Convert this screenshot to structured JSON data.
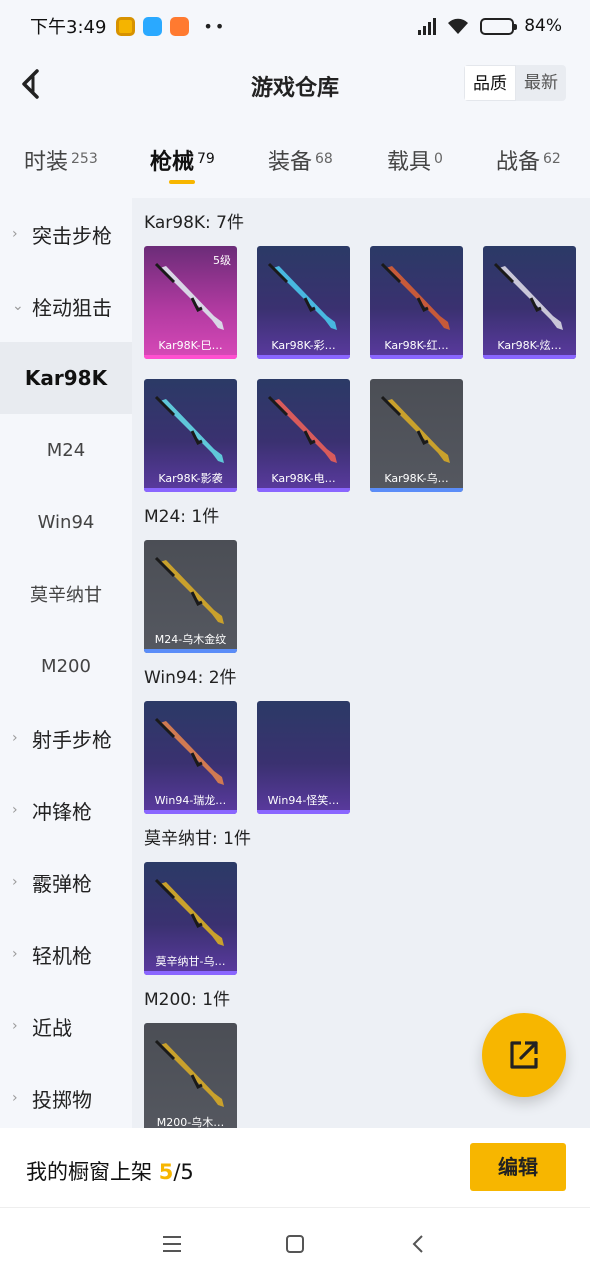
{
  "status": {
    "time": "下午3:49",
    "battery_text": "84%",
    "battery_level": 0.84,
    "app_icons": [
      "wallet-app-icon",
      "chat-app-icon",
      "shop-app-icon"
    ],
    "more": "••"
  },
  "header": {
    "title": "游戏仓库",
    "sort_options": [
      "品质",
      "最新"
    ],
    "sort_selected": "品质"
  },
  "tabs": [
    {
      "label": "时装",
      "count": "253",
      "active": false
    },
    {
      "label": "枪械",
      "count": "79",
      "active": true
    },
    {
      "label": "装备",
      "count": "68",
      "active": false
    },
    {
      "label": "载具",
      "count": "0",
      "active": false
    },
    {
      "label": "战备",
      "count": "62",
      "active": false
    }
  ],
  "sidebar": {
    "items": [
      {
        "label": "突击步枪",
        "type": "group",
        "chevron": "›"
      },
      {
        "label": "栓动狙击",
        "type": "group",
        "chevron": "⌄"
      },
      {
        "label": "Kar98K",
        "type": "sub",
        "active": true
      },
      {
        "label": "M24",
        "type": "sub"
      },
      {
        "label": "Win94",
        "type": "sub"
      },
      {
        "label": "莫辛纳甘",
        "type": "sub"
      },
      {
        "label": "M200",
        "type": "sub"
      },
      {
        "label": "射手步枪",
        "type": "group",
        "chevron": "›"
      },
      {
        "label": "冲锋枪",
        "type": "group",
        "chevron": "›"
      },
      {
        "label": "霰弹枪",
        "type": "group",
        "chevron": "›"
      },
      {
        "label": "轻机枪",
        "type": "group",
        "chevron": "›"
      },
      {
        "label": "近战",
        "type": "group",
        "chevron": "›"
      },
      {
        "label": "投掷物",
        "type": "group",
        "chevron": "›"
      }
    ]
  },
  "sections": [
    {
      "title": "Kar98K: 7件",
      "items": [
        {
          "name": "Kar98K-巳…",
          "rarity": "pink",
          "level": "5级",
          "gun_color": "#d9d6e6"
        },
        {
          "name": "Kar98K-彩…",
          "rarity": "purple",
          "gun_color": "#48b8e0"
        },
        {
          "name": "Kar98K-红…",
          "rarity": "purple",
          "gun_color": "#c75a3a"
        },
        {
          "name": "Kar98K-炫…",
          "rarity": "purple",
          "gun_color": "#c9c7d8"
        },
        {
          "name": "Kar98K-影袭",
          "rarity": "purple",
          "gun_color": "#5fc7d9"
        },
        {
          "name": "Kar98K-电…",
          "rarity": "purple",
          "gun_color": "#d85b5b"
        },
        {
          "name": "Kar98K-乌…",
          "rarity": "grey",
          "gun_color": "#c9a12c"
        }
      ]
    },
    {
      "title": "M24: 1件",
      "items": [
        {
          "name": "M24-乌木金纹",
          "rarity": "grey",
          "gun_color": "#c9a12c"
        }
      ]
    },
    {
      "title": "Win94: 2件",
      "items": [
        {
          "name": "Win94-瑞龙…",
          "rarity": "purple",
          "gun_color": "#d07a52"
        },
        {
          "name": "Win94-怪笑…",
          "rarity": "purple",
          "gun_color": ""
        }
      ]
    },
    {
      "title": "莫辛纳甘: 1件",
      "items": [
        {
          "name": "莫辛纳甘-乌…",
          "rarity": "purple",
          "gun_color": "#c9a12c"
        }
      ]
    },
    {
      "title": "M200: 1件",
      "items": [
        {
          "name": "M200-乌木…",
          "rarity": "grey",
          "gun_color": "#c9a12c"
        }
      ]
    }
  ],
  "showcase": {
    "label": "我的橱窗上架",
    "current": "5",
    "total": "/5",
    "edit_label": "编辑"
  },
  "colors": {
    "accent": "#f7b600",
    "rarity_purple": "#5b3aa0",
    "rarity_pink": "#d849b8",
    "rarity_grey": "#555860"
  }
}
